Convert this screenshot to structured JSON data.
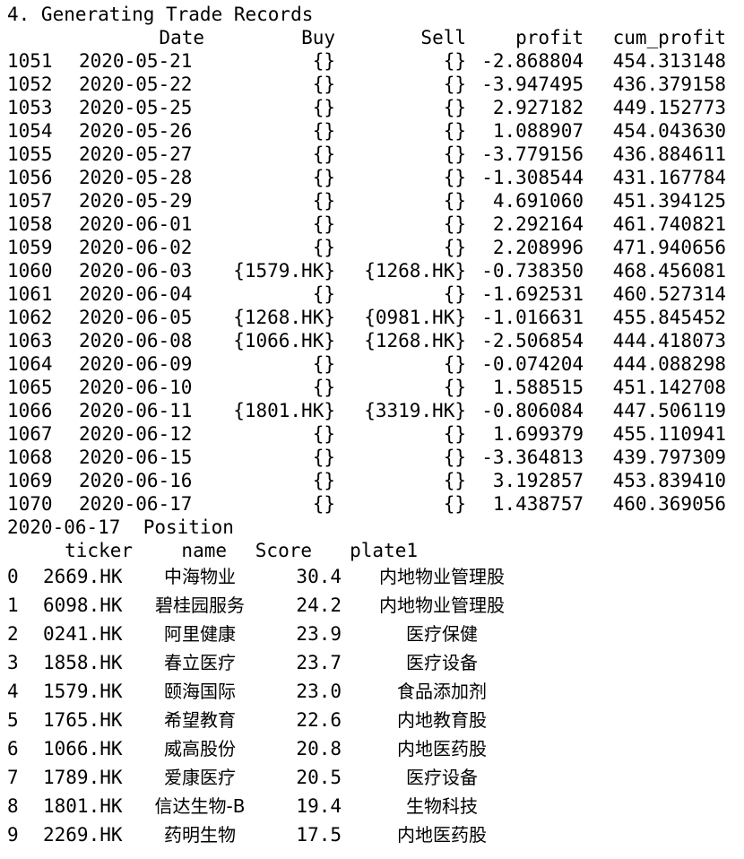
{
  "section_title": "4. Generating Trade Records",
  "trades": {
    "columns": [
      "Date",
      "Buy",
      "Sell",
      "profit",
      "cum_profit"
    ],
    "rows": [
      {
        "idx": "1051",
        "date": "2020-05-21",
        "buy": "{}",
        "sell": "{}",
        "profit": "-2.868804",
        "cum": "454.313148"
      },
      {
        "idx": "1052",
        "date": "2020-05-22",
        "buy": "{}",
        "sell": "{}",
        "profit": "-3.947495",
        "cum": "436.379158"
      },
      {
        "idx": "1053",
        "date": "2020-05-25",
        "buy": "{}",
        "sell": "{}",
        "profit": "2.927182",
        "cum": "449.152773"
      },
      {
        "idx": "1054",
        "date": "2020-05-26",
        "buy": "{}",
        "sell": "{}",
        "profit": "1.088907",
        "cum": "454.043630"
      },
      {
        "idx": "1055",
        "date": "2020-05-27",
        "buy": "{}",
        "sell": "{}",
        "profit": "-3.779156",
        "cum": "436.884611"
      },
      {
        "idx": "1056",
        "date": "2020-05-28",
        "buy": "{}",
        "sell": "{}",
        "profit": "-1.308544",
        "cum": "431.167784"
      },
      {
        "idx": "1057",
        "date": "2020-05-29",
        "buy": "{}",
        "sell": "{}",
        "profit": "4.691060",
        "cum": "451.394125"
      },
      {
        "idx": "1058",
        "date": "2020-06-01",
        "buy": "{}",
        "sell": "{}",
        "profit": "2.292164",
        "cum": "461.740821"
      },
      {
        "idx": "1059",
        "date": "2020-06-02",
        "buy": "{}",
        "sell": "{}",
        "profit": "2.208996",
        "cum": "471.940656"
      },
      {
        "idx": "1060",
        "date": "2020-06-03",
        "buy": "{1579.HK}",
        "sell": "{1268.HK}",
        "profit": "-0.738350",
        "cum": "468.456081"
      },
      {
        "idx": "1061",
        "date": "2020-06-04",
        "buy": "{}",
        "sell": "{}",
        "profit": "-1.692531",
        "cum": "460.527314"
      },
      {
        "idx": "1062",
        "date": "2020-06-05",
        "buy": "{1268.HK}",
        "sell": "{0981.HK}",
        "profit": "-1.016631",
        "cum": "455.845452"
      },
      {
        "idx": "1063",
        "date": "2020-06-08",
        "buy": "{1066.HK}",
        "sell": "{1268.HK}",
        "profit": "-2.506854",
        "cum": "444.418073"
      },
      {
        "idx": "1064",
        "date": "2020-06-09",
        "buy": "{}",
        "sell": "{}",
        "profit": "-0.074204",
        "cum": "444.088298"
      },
      {
        "idx": "1065",
        "date": "2020-06-10",
        "buy": "{}",
        "sell": "{}",
        "profit": "1.588515",
        "cum": "451.142708"
      },
      {
        "idx": "1066",
        "date": "2020-06-11",
        "buy": "{1801.HK}",
        "sell": "{3319.HK}",
        "profit": "-0.806084",
        "cum": "447.506119"
      },
      {
        "idx": "1067",
        "date": "2020-06-12",
        "buy": "{}",
        "sell": "{}",
        "profit": "1.699379",
        "cum": "455.110941"
      },
      {
        "idx": "1068",
        "date": "2020-06-15",
        "buy": "{}",
        "sell": "{}",
        "profit": "-3.364813",
        "cum": "439.797309"
      },
      {
        "idx": "1069",
        "date": "2020-06-16",
        "buy": "{}",
        "sell": "{}",
        "profit": "3.192857",
        "cum": "453.839410"
      },
      {
        "idx": "1070",
        "date": "2020-06-17",
        "buy": "{}",
        "sell": "{}",
        "profit": "1.438757",
        "cum": "460.369056"
      }
    ]
  },
  "position_title": "2020-06-17  Position",
  "positions": {
    "columns": [
      "ticker",
      "name",
      "Score",
      "plate1"
    ],
    "rows": [
      {
        "idx": "0",
        "ticker": "2669.HK",
        "name": "中海物业",
        "score": "30.4",
        "plate": "内地物业管理股"
      },
      {
        "idx": "1",
        "ticker": "6098.HK",
        "name": "碧桂园服务",
        "score": "24.2",
        "plate": "内地物业管理股"
      },
      {
        "idx": "2",
        "ticker": "0241.HK",
        "name": "阿里健康",
        "score": "23.9",
        "plate": "医疗保健"
      },
      {
        "idx": "3",
        "ticker": "1858.HK",
        "name": "春立医疗",
        "score": "23.7",
        "plate": "医疗设备"
      },
      {
        "idx": "4",
        "ticker": "1579.HK",
        "name": "颐海国际",
        "score": "23.0",
        "plate": "食品添加剂"
      },
      {
        "idx": "5",
        "ticker": "1765.HK",
        "name": "希望教育",
        "score": "22.6",
        "plate": "内地教育股"
      },
      {
        "idx": "6",
        "ticker": "1066.HK",
        "name": "威高股份",
        "score": "20.8",
        "plate": "内地医药股"
      },
      {
        "idx": "7",
        "ticker": "1789.HK",
        "name": "爱康医疗",
        "score": "20.5",
        "plate": "医疗设备"
      },
      {
        "idx": "8",
        "ticker": "1801.HK",
        "name": "信达生物-B",
        "score": "19.4",
        "plate": "生物科技"
      },
      {
        "idx": "9",
        "ticker": "2269.HK",
        "name": "药明生物",
        "score": "17.5",
        "plate": "内地医药股"
      }
    ]
  }
}
